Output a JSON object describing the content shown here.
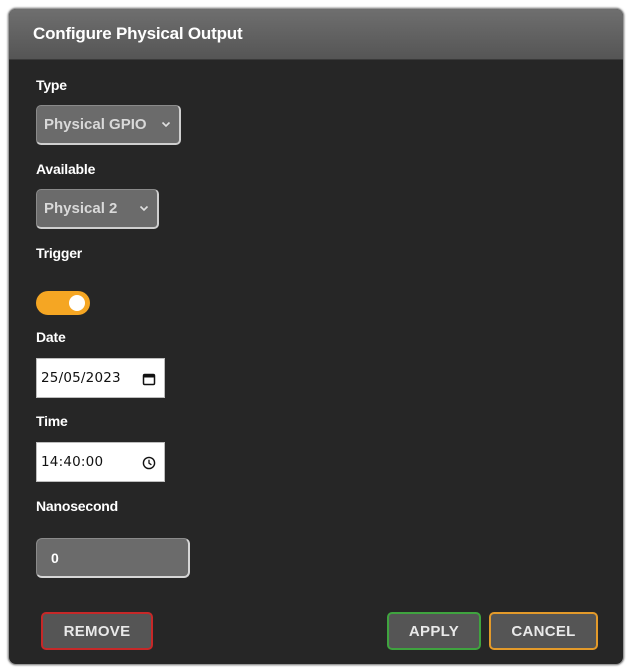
{
  "dialog": {
    "title": "Configure Physical Output"
  },
  "type": {
    "label": "Type",
    "selected": "Physical GPIO"
  },
  "available": {
    "label": "Available",
    "selected": "Physical 2"
  },
  "trigger": {
    "label": "Trigger",
    "on": true,
    "color": "#f5a623"
  },
  "date": {
    "label": "Date",
    "value": "25/05/2023",
    "icon": "calendar-icon"
  },
  "time": {
    "label": "Time",
    "value": "14:40:00",
    "icon": "clock-icon"
  },
  "nanosecond": {
    "label": "Nanosecond",
    "value": "0"
  },
  "buttons": {
    "remove": "REMOVE",
    "apply": "APPLY",
    "cancel": "CANCEL",
    "remove_color": "#c62828",
    "apply_color": "#3fa33f",
    "cancel_color": "#e39a2a"
  }
}
